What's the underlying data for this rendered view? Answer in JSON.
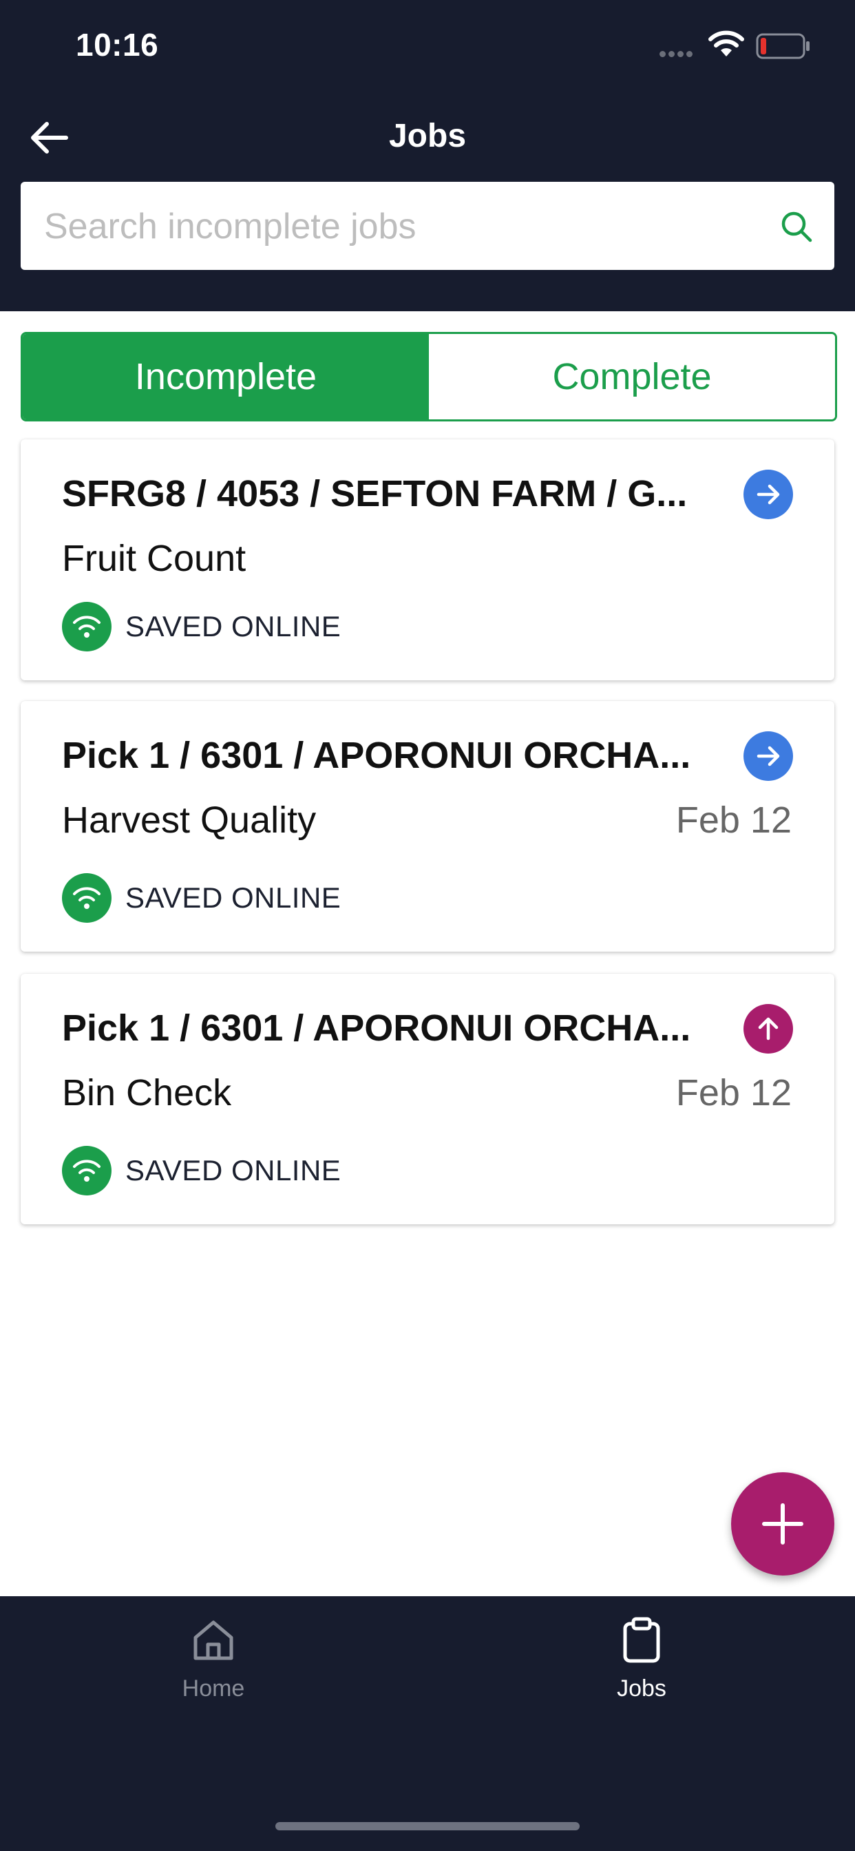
{
  "status_bar": {
    "time": "10:16"
  },
  "header": {
    "title": "Jobs"
  },
  "search": {
    "placeholder": "Search incomplete jobs"
  },
  "segments": {
    "incomplete": "Incomplete",
    "complete": "Complete",
    "active": "Incomplete"
  },
  "jobs": [
    {
      "title": "SFRG8 / 4053 / SEFTON FARM / G...",
      "type": "Fruit Count",
      "date": "",
      "status": "SAVED ONLINE",
      "action_icon": "arrow-right-icon",
      "action_color": "#3d7be0"
    },
    {
      "title": "Pick 1 / 6301 / APORONUI ORCHA...",
      "type": "Harvest Quality",
      "date": "Feb 12",
      "status": "SAVED ONLINE",
      "action_icon": "arrow-right-icon",
      "action_color": "#3d7be0"
    },
    {
      "title": "Pick 1 / 6301 / APORONUI ORCHA...",
      "type": "Bin Check",
      "date": "Feb 12",
      "status": "SAVED ONLINE",
      "action_icon": "arrow-up-icon",
      "action_color": "#a81d6c"
    }
  ],
  "fab": {
    "icon": "plus-icon",
    "color": "#a81d6c"
  },
  "tabbar": {
    "home": {
      "label": "Home",
      "icon": "home-icon"
    },
    "jobs": {
      "label": "Jobs",
      "icon": "clipboard-icon"
    },
    "active": "Jobs"
  },
  "colors": {
    "header_bg": "#171c2e",
    "accent_green": "#1b9e4b",
    "accent_blue": "#3d7be0",
    "accent_magenta": "#a81d6c"
  }
}
